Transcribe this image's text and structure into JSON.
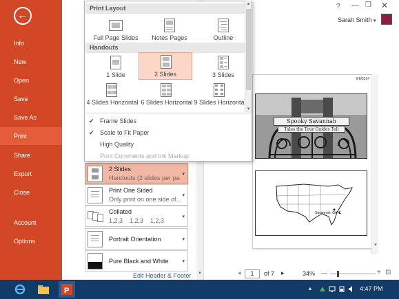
{
  "sidebar": {
    "back_glyph": "←",
    "items": [
      {
        "label": "Info"
      },
      {
        "label": "New"
      },
      {
        "label": "Open"
      },
      {
        "label": "Save"
      },
      {
        "label": "Save As"
      },
      {
        "label": "Print"
      },
      {
        "label": "Share"
      },
      {
        "label": "Export"
      },
      {
        "label": "Close"
      },
      {
        "label": "Account"
      },
      {
        "label": "Options"
      }
    ],
    "active_color": "#e45c3a",
    "bg_color": "#d24726"
  },
  "window": {
    "help": "?",
    "minimize": "—",
    "maximize": "❐",
    "close": "✕",
    "user_name": "Sarah Smith",
    "user_chevron": "▾"
  },
  "gallery": {
    "print_layout_header": "Print Layout",
    "print_layout": [
      {
        "label": "Full Page Slides"
      },
      {
        "label": "Notes Pages"
      },
      {
        "label": "Outline"
      }
    ],
    "handouts_header": "Handouts",
    "handouts": [
      {
        "label": "1 Slide"
      },
      {
        "label": "2 Slides"
      },
      {
        "label": "3 Slides"
      },
      {
        "label": "4 Slides Horizontal"
      },
      {
        "label": "6 Slides Horizontal"
      },
      {
        "label": "9 Slides Horizontal"
      }
    ],
    "options": [
      {
        "label": "Frame Slides",
        "checked": "✔"
      },
      {
        "label": "Scale to Fit Paper",
        "checked": "✔"
      },
      {
        "label": "High Quality",
        "checked": ""
      },
      {
        "label": "Print Comments and Ink Markup",
        "checked": ""
      }
    ],
    "scroll_up": "▴",
    "scroll_down": "▾"
  },
  "settings": {
    "layout": {
      "title": "2 Slides",
      "subtitle": "Handouts (2 slides per pa..."
    },
    "sides": {
      "title": "Print One Sided",
      "subtitle": "Only print on one side of..."
    },
    "collation": {
      "title": "Collated",
      "subtitle": "1,2,3    1,2,3    1,2,3"
    },
    "orientation": {
      "title": "Portrait Orientation"
    },
    "color": {
      "title": "Pure Black and White"
    },
    "dropdown_arrow": "▾",
    "edit_header_footer": "Edit Header & Footer"
  },
  "preview": {
    "page_number": "6/8/2014",
    "slide1_title": "Spooky Savannah",
    "slide1_subtitle": "Tales the Tour Guides Tell",
    "slide2_label": "Savannah, GA",
    "scroll_down": "▾"
  },
  "pager": {
    "prev": "◂",
    "current_page": "1",
    "of_text": "of 7",
    "next": "▸",
    "zoom": "34%",
    "zoom_minus": "—",
    "zoom_plus": "+",
    "fit": "⊡"
  },
  "taskbar": {
    "tray_up": "▴",
    "time": "4:47 PM"
  }
}
